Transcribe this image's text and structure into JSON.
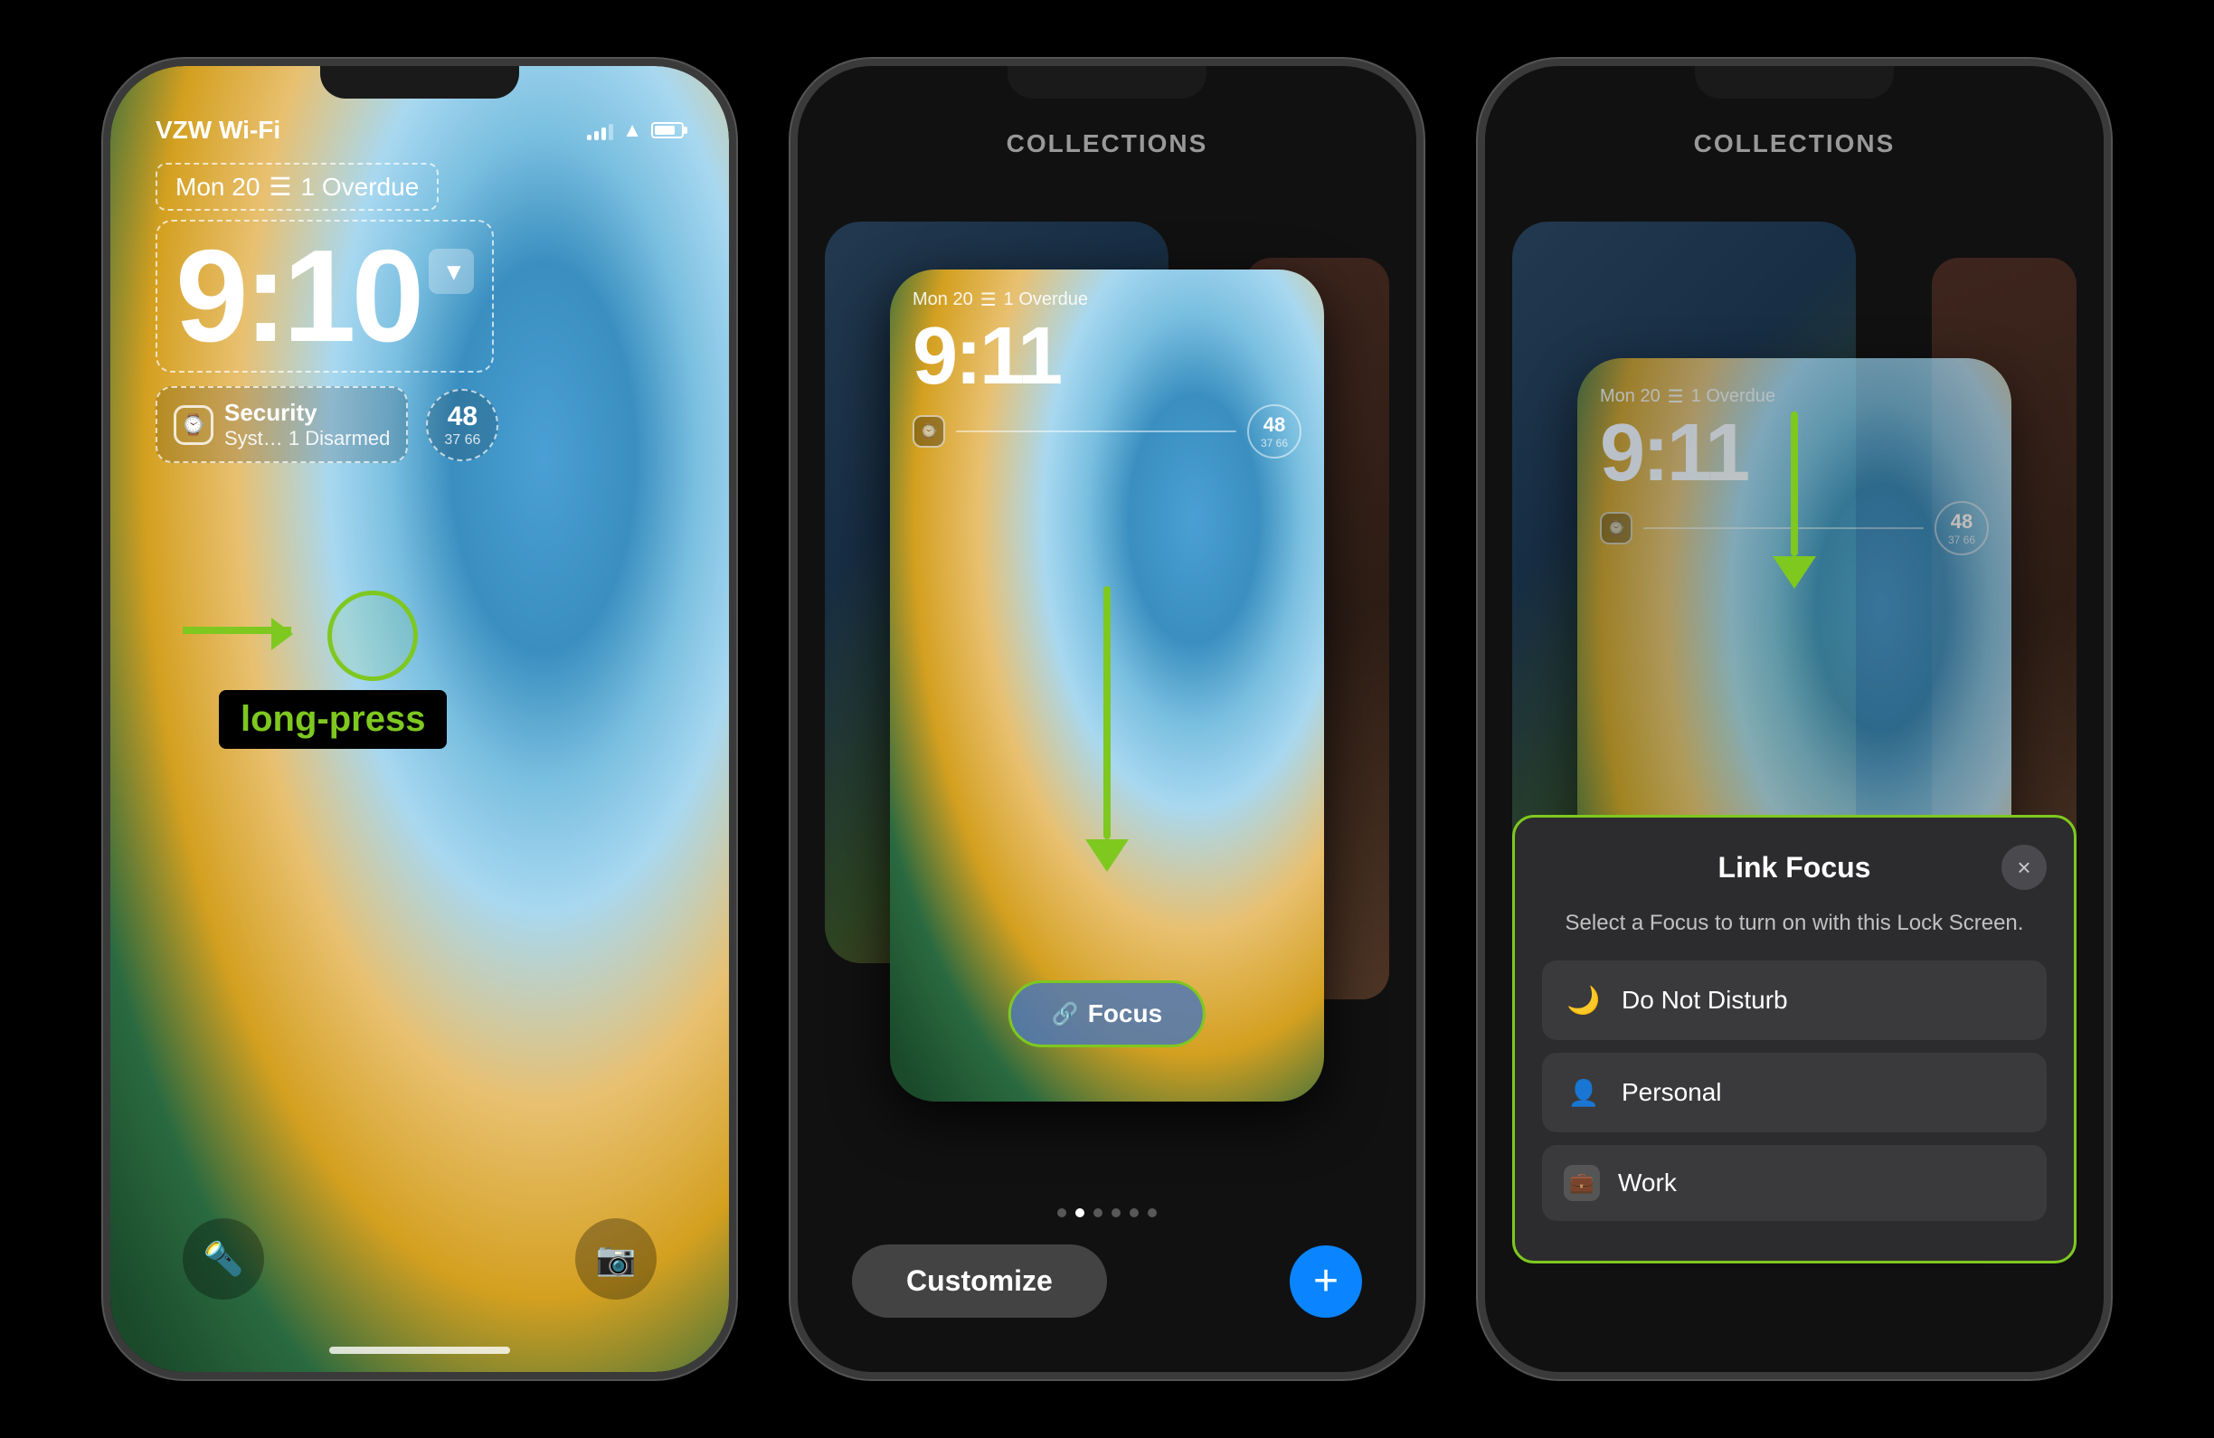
{
  "phones": [
    {
      "id": "phone1",
      "type": "lockscreen",
      "status_bar": {
        "carrier": "VZW Wi-Fi",
        "signal_strength": 3,
        "wifi": true,
        "battery_pct": 80
      },
      "date": "Mon 20",
      "overdue": "1 Overdue",
      "time": "9:10",
      "widgets": {
        "security_title": "Security",
        "security_sub": "Syst… 1 Disarmed",
        "temp": "48",
        "temp_range": "37 66"
      },
      "annotation": {
        "arrow_label": "→",
        "long_press_label": "long-press"
      }
    },
    {
      "id": "phone2",
      "type": "collections",
      "header": "COLLECTIONS",
      "time": "9:11",
      "date": "Mon 20",
      "overdue": "1 Overdue",
      "temp": "48",
      "temp_range": "37 66",
      "focus_button": "Focus",
      "dots_count": 6,
      "active_dot": 1,
      "customize_label": "Customize",
      "add_label": "+"
    },
    {
      "id": "phone3",
      "type": "link-focus",
      "header": "COLLECTIONS",
      "time": "9:11",
      "date": "Mon 20",
      "overdue": "1 Overdue",
      "temp": "48",
      "temp_range": "37 66",
      "modal": {
        "title": "Link Focus",
        "description": "Select a Focus to turn on with this Lock Screen.",
        "close_icon": "×",
        "options": [
          {
            "icon": "🌙",
            "label": "Do Not Disturb",
            "type": "moon"
          },
          {
            "icon": "👤",
            "label": "Personal",
            "type": "person"
          },
          {
            "icon": "💼",
            "label": "Work",
            "type": "work"
          }
        ]
      }
    }
  ]
}
